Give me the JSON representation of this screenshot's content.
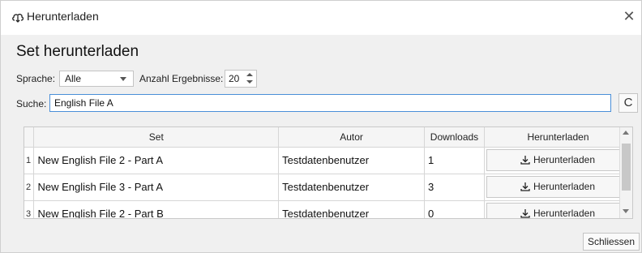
{
  "window": {
    "title": "Herunterladen",
    "close_symbol": "✕",
    "icon": "cloud-download-icon"
  },
  "heading": "Set herunterladen",
  "filters": {
    "language_label": "Sprache:",
    "language_value": "Alle",
    "results_label": "Anzahl Ergebnisse:",
    "results_value": "20"
  },
  "search": {
    "label": "Suche:",
    "value": "English File A",
    "refresh_icon": "refresh-icon",
    "refresh_symbol": "C"
  },
  "table": {
    "columns": {
      "set": "Set",
      "author": "Autor",
      "downloads": "Downloads",
      "download": "Herunterladen"
    },
    "rows": [
      {
        "num": "1",
        "set": "New English File 2 - Part A",
        "author": "Testdatenbenutzer",
        "downloads": "1",
        "button": "Herunterladen"
      },
      {
        "num": "2",
        "set": "New English File 3 - Part A",
        "author": "Testdatenbenutzer",
        "downloads": "3",
        "button": "Herunterladen"
      },
      {
        "num": "3",
        "set": "New English File 2 - Part B",
        "author": "Testdatenbenutzer",
        "downloads": "0",
        "button": "Herunterladen"
      }
    ]
  },
  "footer": {
    "close_label": "Schliessen"
  }
}
